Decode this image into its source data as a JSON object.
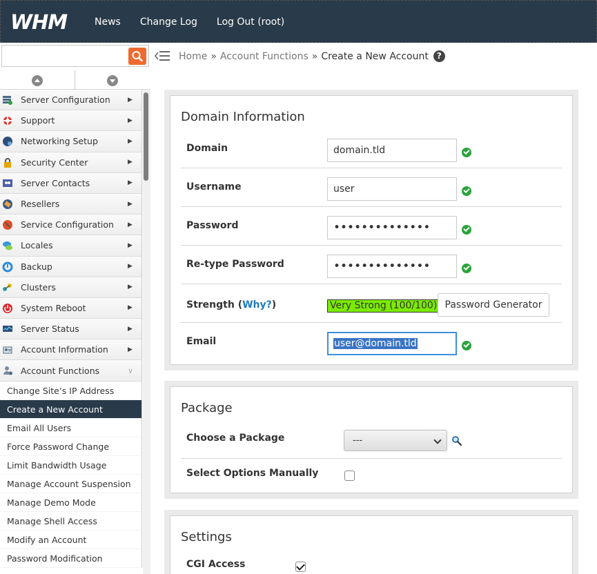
{
  "app": {
    "logo_text": "WHM",
    "brand_color": "#293a4a",
    "accent_color": "#ef6a31"
  },
  "topnav": {
    "news": "News",
    "changelog": "Change Log",
    "logout": "Log Out (root)"
  },
  "search": {
    "value": "",
    "icon": "search-icon"
  },
  "breadcrumb": {
    "home": "Home",
    "section": "Account Functions",
    "current": "Create a New Account",
    "sep": "»",
    "help": "?"
  },
  "sidebar": {
    "items": [
      {
        "label": "Server Configuration",
        "icon": "server-config-icon"
      },
      {
        "label": "Support",
        "icon": "lifebuoy-icon"
      },
      {
        "label": "Networking Setup",
        "icon": "globe-icon"
      },
      {
        "label": "Security Center",
        "icon": "lock-icon"
      },
      {
        "label": "Server Contacts",
        "icon": "contacts-icon"
      },
      {
        "label": "Resellers",
        "icon": "tag-icon"
      },
      {
        "label": "Service Configuration",
        "icon": "wrench-icon"
      },
      {
        "label": "Locales",
        "icon": "speech-icon"
      },
      {
        "label": "Backup",
        "icon": "backup-icon"
      },
      {
        "label": "Clusters",
        "icon": "cluster-icon"
      },
      {
        "label": "System Reboot",
        "icon": "power-icon"
      },
      {
        "label": "Server Status",
        "icon": "monitor-icon"
      },
      {
        "label": "Account Information",
        "icon": "account-info-icon"
      },
      {
        "label": "Account Functions",
        "icon": "user-gear-icon"
      }
    ],
    "collapsed_caret": "▶",
    "open_caret": "∨",
    "sub_items": [
      "Change Site’s IP Address",
      "Create a New Account",
      "Email All Users",
      "Force Password Change",
      "Limit Bandwidth Usage",
      "Manage Account Suspension",
      "Manage Demo Mode",
      "Manage Shell Access",
      "Modify an Account",
      "Password Modification"
    ],
    "active_sub": "Create a New Account"
  },
  "domain_info": {
    "title": "Domain Information",
    "domain_label": "Domain",
    "domain_value": "domain.tld",
    "username_label": "Username",
    "username_value": "user",
    "password_label": "Password",
    "password_value": "••••••••••••••",
    "retype_label": "Re-type Password",
    "retype_value": "••••••••••••••",
    "strength_label": "Strength (",
    "strength_why": "Why?",
    "strength_close": ")",
    "strength_value": "Very Strong (100/100)",
    "pwgen_label": "Password Generator",
    "email_label": "Email",
    "email_value": "user@domain.tld"
  },
  "package": {
    "title": "Package",
    "choose_label": "Choose a Package",
    "choose_value": "---",
    "manual_label": "Select Options Manually",
    "manual_checked": false
  },
  "settings": {
    "title": "Settings",
    "cgi_label": "CGI Access",
    "cgi_checked": true
  }
}
